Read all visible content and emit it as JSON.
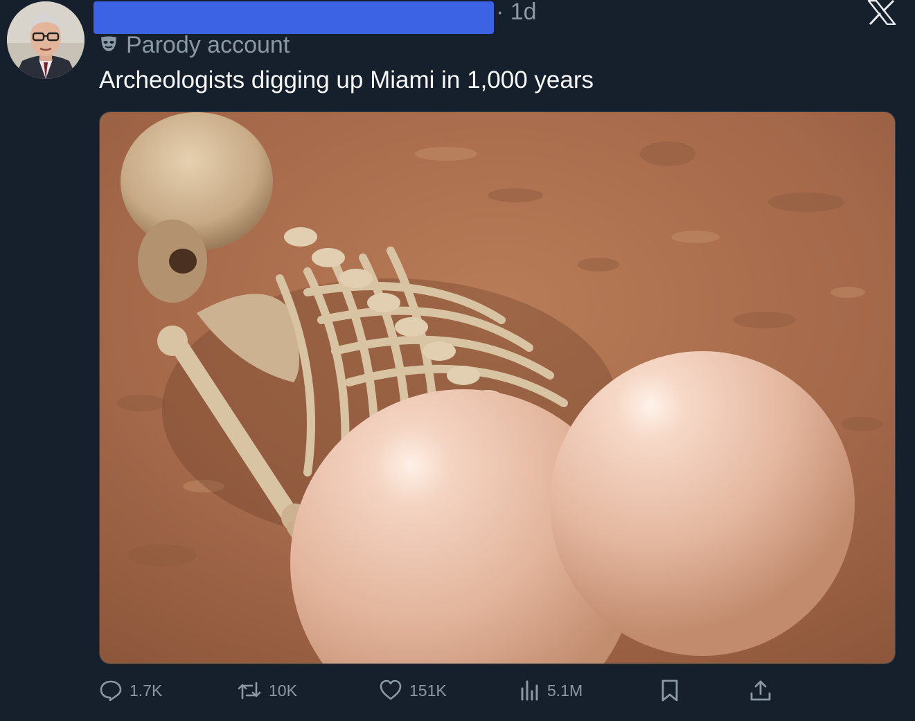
{
  "header": {
    "timestamp": "· 1d",
    "parody_label": "Parody account"
  },
  "tweet": {
    "text": "Archeologists digging up Miami in 1,000 years"
  },
  "actions": {
    "replies": "1.7K",
    "reposts": "10K",
    "likes": "151K",
    "views": "5.1M"
  },
  "icons": {
    "brand": "x-logo-icon",
    "parody": "mask-icon",
    "reply": "reply-icon",
    "repost": "repost-icon",
    "like": "heart-icon",
    "views": "views-icon",
    "bookmark": "bookmark-icon",
    "share": "share-icon"
  },
  "colors": {
    "background": "#16202c",
    "redaction": "#3b63e4",
    "muted_text": "#8b98a5",
    "primary_text": "#f7f9f9"
  }
}
